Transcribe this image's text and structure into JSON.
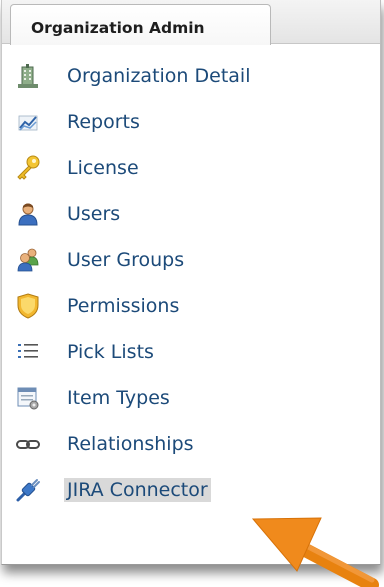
{
  "tab": {
    "label": "Organization Admin"
  },
  "menu": {
    "items": [
      {
        "label": "Organization Detail",
        "icon": "building-icon"
      },
      {
        "label": "Reports",
        "icon": "line-chart-icon"
      },
      {
        "label": "License",
        "icon": "key-icon"
      },
      {
        "label": "Users",
        "icon": "user-icon"
      },
      {
        "label": "User Groups",
        "icon": "user-group-icon"
      },
      {
        "label": "Permissions",
        "icon": "shield-icon"
      },
      {
        "label": "Pick Lists",
        "icon": "list-icon"
      },
      {
        "label": "Item Types",
        "icon": "item-types-icon"
      },
      {
        "label": "Relationships",
        "icon": "chain-link-icon"
      },
      {
        "label": "JIRA Connector",
        "icon": "connector-plug-icon",
        "selected": true
      }
    ]
  },
  "colors": {
    "link": "#1c4a79",
    "selected_bg": "#d9d9d9",
    "arrow": "#f08a1c"
  }
}
